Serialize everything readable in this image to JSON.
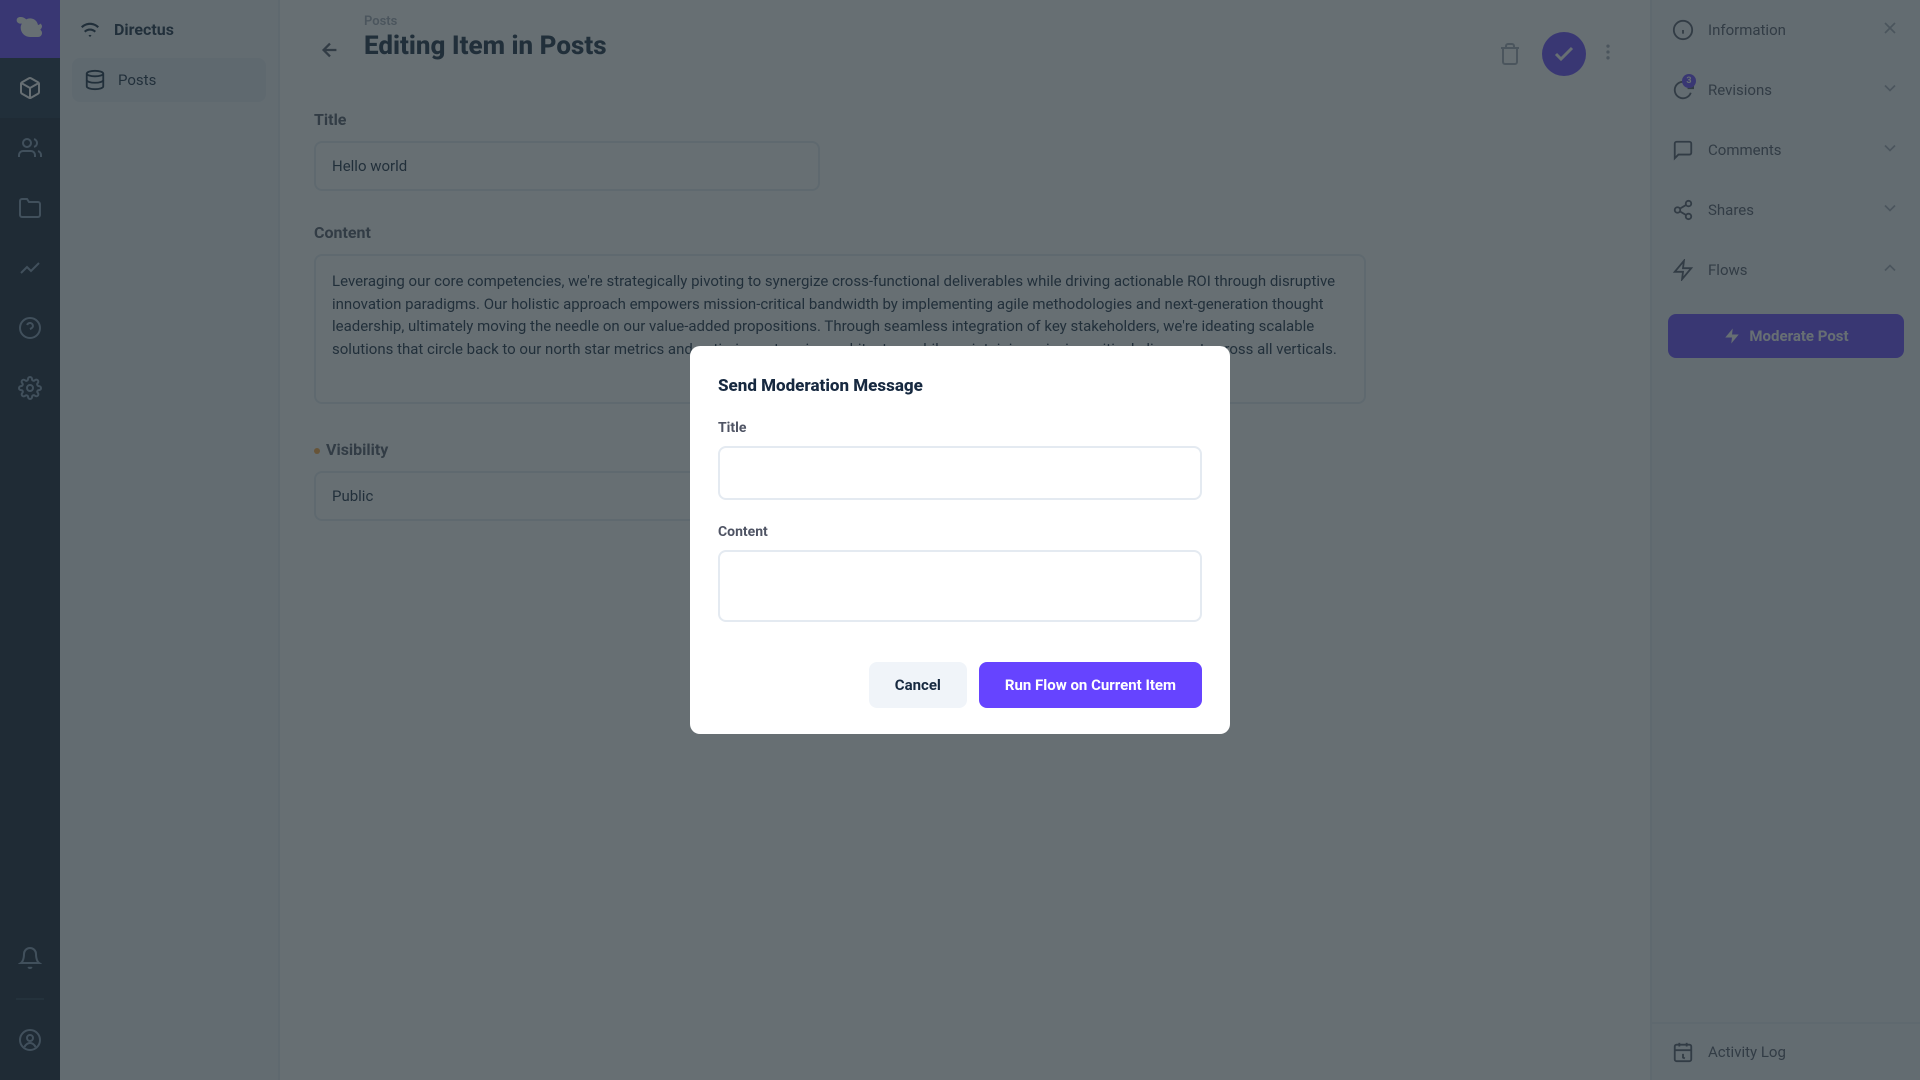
{
  "brand": {
    "name": "Directus"
  },
  "nav": {
    "collection": {
      "icon": "database-icon",
      "label": "Posts"
    }
  },
  "header": {
    "breadcrumb": "Posts",
    "title": "Editing Item in Posts"
  },
  "form": {
    "title": {
      "label": "Title",
      "value": "Hello world"
    },
    "content": {
      "label": "Content",
      "value": "Leveraging our core competencies, we're strategically pivoting to synergize cross-functional deliverables while driving actionable ROI through disruptive innovation paradigms. Our holistic approach empowers mission-critical bandwidth by implementing agile methodologies and next-generation thought leadership, ultimately moving the needle on our value-added propositions. Through seamless integration of key stakeholders, we're ideating scalable solutions that circle back to our north star metrics and optimize enterprise architecture while maintaining mission-critical alignment across all verticals."
    },
    "visibility": {
      "label": "Visibility",
      "value": "Public"
    }
  },
  "right_sidebar": {
    "information": "Information",
    "revisions": {
      "label": "Revisions",
      "badge": "3"
    },
    "comments": "Comments",
    "shares": "Shares",
    "flows": "Flows",
    "flow_button": "Moderate Post",
    "activity_log": "Activity Log"
  },
  "modal": {
    "title": "Send Moderation Message",
    "field_title": "Title",
    "field_content": "Content",
    "cancel": "Cancel",
    "run": "Run Flow on Current Item"
  }
}
